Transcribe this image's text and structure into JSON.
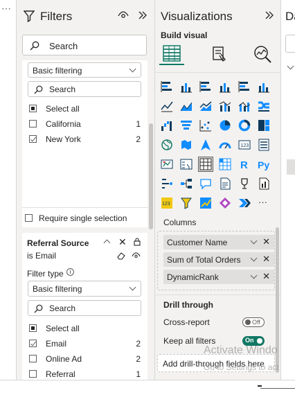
{
  "left_strip": {
    "more_glyph": "⋯"
  },
  "filters": {
    "title": "Filters",
    "search_placeholder": "Search",
    "card1": {
      "filter_type_value": "Basic filtering",
      "search_placeholder": "Search",
      "items": [
        {
          "label": "Select all",
          "count": "",
          "state": "partial"
        },
        {
          "label": "California",
          "count": "1",
          "state": "unchecked"
        },
        {
          "label": "New York",
          "count": "2",
          "state": "checked"
        }
      ],
      "require_single": "Require single selection"
    },
    "card2": {
      "title": "Referral Source",
      "subtitle": "is Email",
      "filter_type_label": "Filter type",
      "filter_type_value": "Basic filtering",
      "search_placeholder": "Search",
      "items": [
        {
          "label": "Select all",
          "count": "",
          "state": "partial"
        },
        {
          "label": "Email",
          "count": "2",
          "state": "checked"
        },
        {
          "label": "Online Ad",
          "count": "2",
          "state": "unchecked"
        },
        {
          "label": "Referral",
          "count": "1",
          "state": "unchecked"
        }
      ]
    }
  },
  "visualizations": {
    "title": "Visualizations",
    "build_visual": "Build visual",
    "columns_label": "Columns",
    "fields": [
      "Customer Name",
      "Sum of Total Orders",
      "DynamicRank"
    ],
    "drill_through": "Drill through",
    "cross_report": "Cross-report",
    "cross_report_toggle": "Off",
    "keep_all_filters": "Keep all filters",
    "keep_all_filters_toggle": "On",
    "add_drill": "Add drill-through fields here",
    "gallery_text": {
      "card_number": "123",
      "r_visual": "R",
      "python_visual": "Py",
      "more": "···"
    }
  },
  "data_pane": {
    "title_fragment": "Da"
  },
  "watermark": {
    "line1": "Activate Windo",
    "line2": "Go to Settings to act"
  },
  "colors": {
    "accent": "#117865",
    "visual_blue": "#118dff",
    "visual_dark": "#0d3a5c"
  }
}
